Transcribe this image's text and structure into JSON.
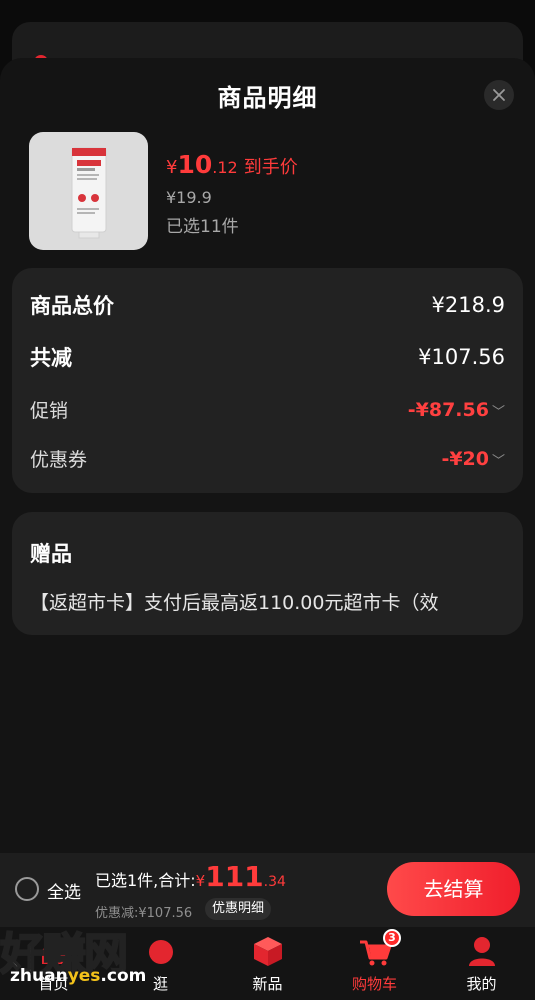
{
  "sheet": {
    "title": "商品明细"
  },
  "product": {
    "price_symbol": "¥",
    "price_int": "10",
    "price_dec": ".12",
    "price_tag": "到手价",
    "original_price": "¥19.9",
    "selected_qty": "已选11件",
    "tube_brand": "sdtwhiten"
  },
  "summary": {
    "total_label": "商品总价",
    "total_value": "¥218.9",
    "reduce_label": "共减",
    "reduce_value": "¥107.56",
    "promo_label": "促销",
    "promo_value": "-¥87.56",
    "coupon_label": "优惠券",
    "coupon_value": "-¥20"
  },
  "gift": {
    "title": "赠品",
    "text": "【返超市卡】支付后最高返110.00元超市卡（效"
  },
  "bottom_bar": {
    "select_all": "全选",
    "sum_label": "已选1件,合计:",
    "sum_symbol": "¥",
    "sum_int": "111",
    "sum_dec": ".34",
    "discount": "优惠减:¥107.56",
    "detail_chip": "优惠明细",
    "checkout": "去结算"
  },
  "tabs": [
    {
      "label": "首页",
      "icon": "home-icon"
    },
    {
      "label": "逛",
      "icon": "browse-icon"
    },
    {
      "label": "新品",
      "icon": "new-box-icon"
    },
    {
      "label": "购物车",
      "icon": "cart-icon",
      "badge": "3",
      "active": true
    },
    {
      "label": "我的",
      "icon": "profile-icon"
    }
  ],
  "watermark": {
    "text": "好赚网",
    "url_a": "zhuan",
    "url_b": "yes",
    "url_c": ".com"
  },
  "colors": {
    "accent": "#ff3b3b",
    "background": "#0b0b0b",
    "card": "#222222",
    "sheet": "#141414"
  }
}
